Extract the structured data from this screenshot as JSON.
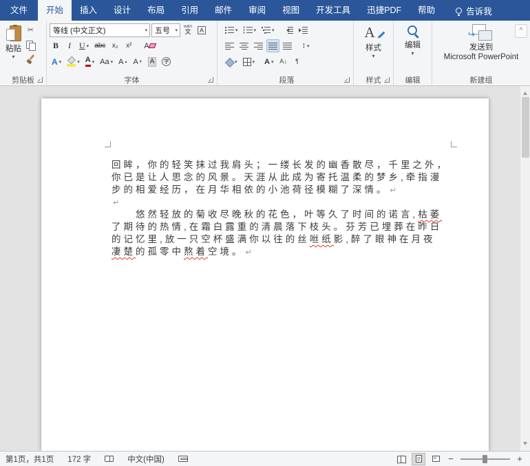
{
  "colors": {
    "title_bar_blue": "#2B579A",
    "squiggle_red": "#DD3A2A",
    "font_color_bar": "#C00000",
    "highlight_yellow": "#F6E94E"
  },
  "icons": {
    "dropdown": "▾",
    "scissors": "✂",
    "pilcrow": "↵",
    "line_spacing": "↕",
    "sort": "A↓",
    "paragraph_mark": "¶",
    "zoom_out": "−",
    "zoom_in": "+",
    "collapse_ribbon": "^",
    "send_arrow": "↪"
  },
  "tabs": {
    "items": [
      {
        "label": "文件"
      },
      {
        "label": "开始",
        "active": true
      },
      {
        "label": "插入"
      },
      {
        "label": "设计"
      },
      {
        "label": "布局"
      },
      {
        "label": "引用"
      },
      {
        "label": "邮件"
      },
      {
        "label": "审阅"
      },
      {
        "label": "视图"
      },
      {
        "label": "开发工具"
      },
      {
        "label": "迅捷PDF"
      },
      {
        "label": "帮助"
      }
    ],
    "tell_me": "告诉我"
  },
  "ribbon": {
    "clipboard": {
      "group_label": "剪贴板",
      "paste_label": "粘贴"
    },
    "font": {
      "group_label": "字体",
      "font_name": "等线 (中文正文)",
      "font_size": "五号",
      "glyphs": {
        "bold": "B",
        "italic": "I",
        "underline": "U",
        "strikethrough": "abc",
        "subscript": "x₂",
        "superscript": "x²",
        "clear_format": "A",
        "text_effects": "A",
        "font_color": "A",
        "change_case": "Aa",
        "grow_font": "A",
        "shrink_font": "A",
        "char_shading": "A",
        "enclose_char": "字",
        "char_border": "A",
        "pinyin_top": "wén",
        "pinyin_bottom": "文"
      }
    },
    "paragraph": {
      "group_label": "段落",
      "glyphs": {
        "cjk_layout": "A"
      }
    },
    "styles": {
      "group_label": "样式",
      "button_label": "样式",
      "big_a": "A"
    },
    "editing": {
      "group_label": "编辑",
      "button_label": "编辑"
    },
    "new_group": {
      "group_label": "新建组",
      "button_line1": "发送到",
      "button_line2": "Microsoft PowerPoint"
    }
  },
  "document": {
    "lines": [
      {
        "indent": false,
        "pilcrow": false,
        "segments": [
          {
            "text": "回眸，你的轻笑抹过我肩头；一缕长发的幽香散尽，千里之外，",
            "misspelled": false
          }
        ]
      },
      {
        "indent": false,
        "pilcrow": false,
        "segments": [
          {
            "text": "你已是让人思念的风景。天涯从此成为寄托温柔的梦乡,牵指漫",
            "misspelled": false
          }
        ]
      },
      {
        "indent": false,
        "pilcrow": true,
        "segments": [
          {
            "text": "步的相爱经历，在月华相依的小池荷径模糊了深情。",
            "misspelled": false
          }
        ]
      },
      {
        "indent": false,
        "pilcrow": true,
        "segments": []
      },
      {
        "indent": true,
        "pilcrow": false,
        "segments": [
          {
            "text": "悠然轻放的菊收尽晚秋的花色，叶等久了时间的诺言,",
            "misspelled": false
          },
          {
            "text": "枯萎",
            "misspelled": true
          }
        ]
      },
      {
        "indent": false,
        "pilcrow": false,
        "segments": [
          {
            "text": "了期待的热情,在霜白露重的清晨落下枝头。芬芳已埋葬在昨日",
            "misspelled": false
          }
        ]
      },
      {
        "indent": false,
        "pilcrow": false,
        "segments": [
          {
            "text": "的记忆里,放一只空杯盛满你以往的丝",
            "misspelled": false
          },
          {
            "text": "咝纸",
            "misspelled": true
          },
          {
            "text": "影,醉了眼神在月夜",
            "misspelled": false
          }
        ]
      },
      {
        "indent": false,
        "pilcrow": true,
        "segments": [
          {
            "text": "凄楚",
            "misspelled": true
          },
          {
            "text": "的孤零中",
            "misspelled": false
          },
          {
            "text": "熬着",
            "misspelled": true
          },
          {
            "text": "空境。",
            "misspelled": false
          }
        ]
      }
    ]
  },
  "status_bar": {
    "page_info": "第1页，共1页",
    "word_count": "172 字",
    "language": "中文(中国)"
  }
}
